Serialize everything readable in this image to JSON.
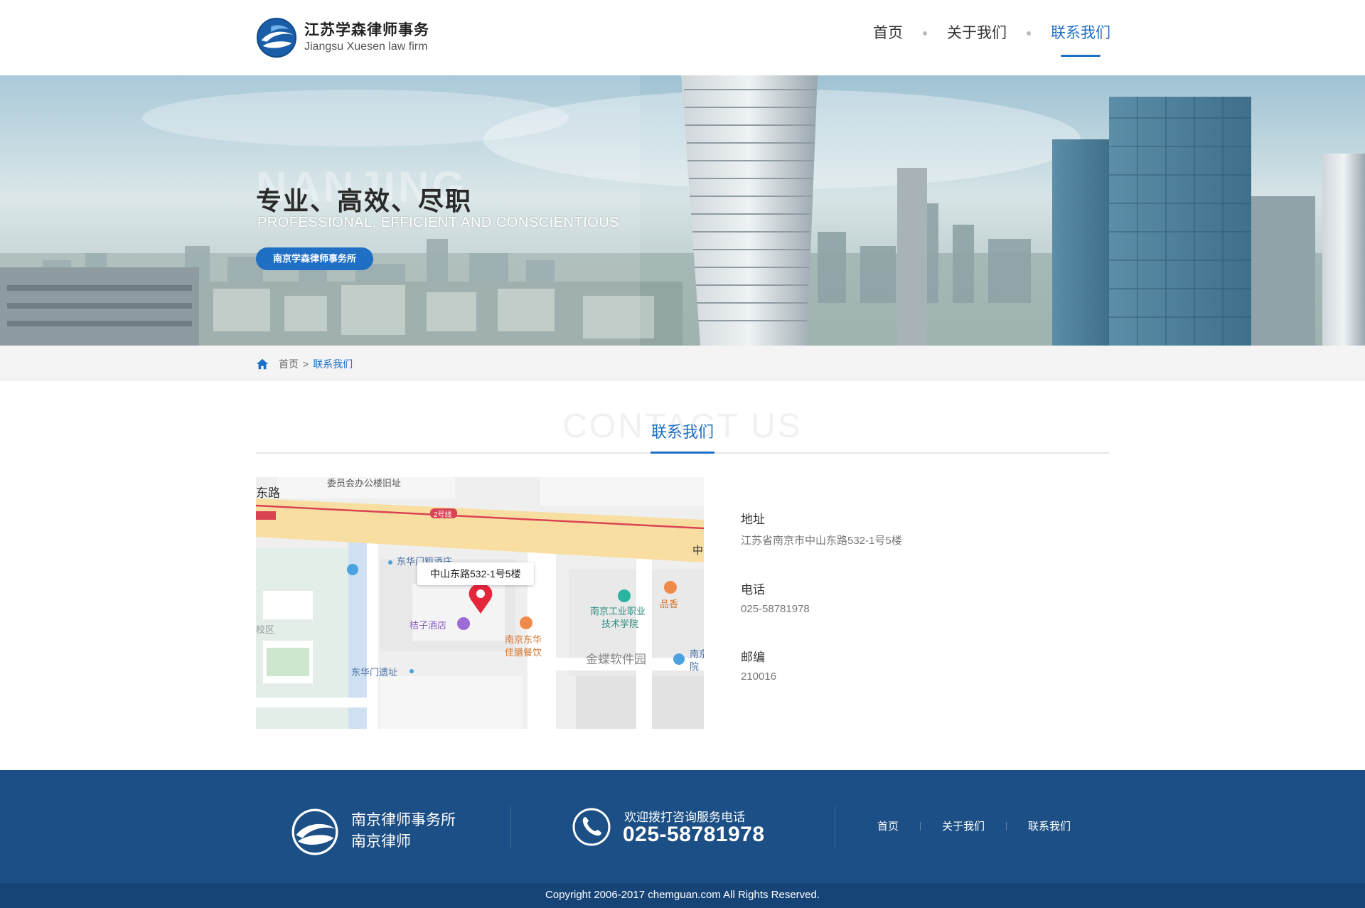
{
  "header": {
    "logo_cn": "江苏学森律师事务",
    "logo_en": "Jiangsu Xuesen law firm",
    "nav": [
      {
        "label": "首页"
      },
      {
        "label": "关于我们"
      },
      {
        "label": "联系我们"
      }
    ],
    "active_nav": "联系我们"
  },
  "banner": {
    "watermark": "NANJING",
    "title": "专业、高效、尽职",
    "subtitle": "PROFESSIONAL, EFFICIENT AND CONSCIENTIOUS",
    "button": "南京学森律师事务所"
  },
  "breadcrumb": {
    "home": "首页",
    "separator": ">",
    "current": "联系我们"
  },
  "section": {
    "watermark": "CONTACT US",
    "title": "联系我们"
  },
  "map": {
    "callout": "中山东路532-1号5楼",
    "labels": {
      "committee": "委员会办公楼旧址",
      "east_road": "东路",
      "line2": "2号线",
      "zhong": "中",
      "donghua_hotel": "东华门粗酒庄",
      "hotel": "桔子酒店",
      "restaurant_1": "南京东华",
      "restaurant_2": "佳膳餐饮",
      "college_1": "南京工业职业",
      "college_2": "技术学院",
      "pinxiang": "品香",
      "software_park": "金蝶软件园",
      "ruins": "东华门遗址",
      "xiaoqu": "校区",
      "nanjing_1": "南京",
      "nanjing_2": "院"
    }
  },
  "contact": {
    "address_label": "地址",
    "address": "江苏省南京市中山东路532-1号5楼",
    "phone_label": "电话",
    "phone": "025-58781978",
    "postcode_label": "邮编",
    "postcode": "210016"
  },
  "footer": {
    "name_1": "南京律师事务所",
    "name_2": "南京律师",
    "phone_caption": "欢迎拨打咨询服务电话",
    "phone": "025-58781978",
    "nav": [
      "首页",
      "关于我们",
      "联系我们"
    ],
    "copyright": "Copyright 2006-2017 chemguan.com All Rights Reserved."
  },
  "colors": {
    "accent": "#1f6fc5",
    "footer": "#1c4f85",
    "copyright_bar": "#174477"
  }
}
